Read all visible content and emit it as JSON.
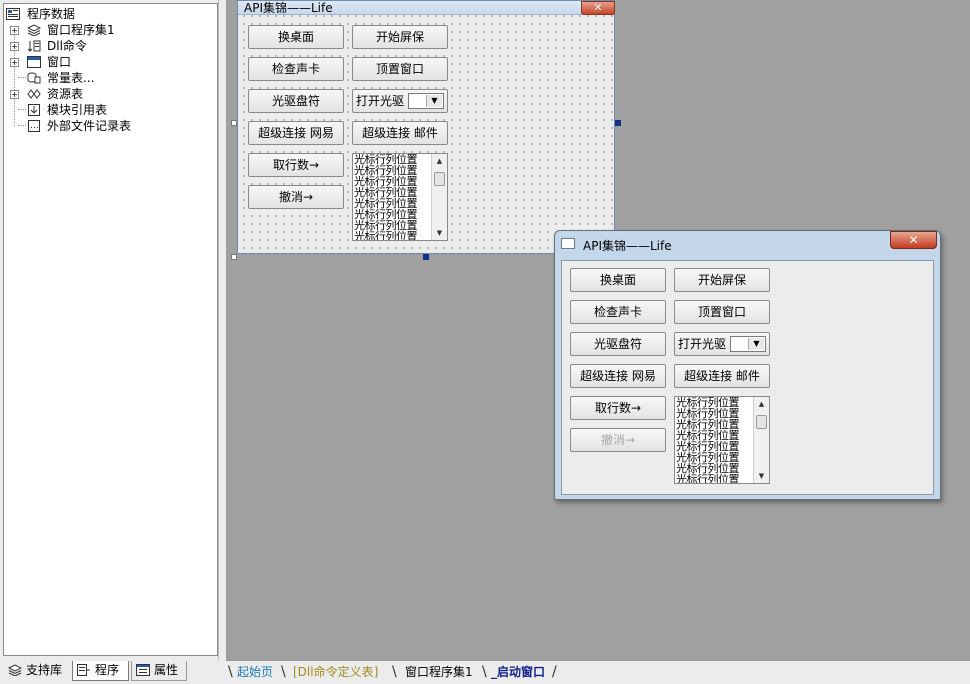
{
  "tree": {
    "root": "程序数据",
    "items": [
      {
        "label": "窗口程序集1",
        "icon": "layers-icon",
        "expander": "+"
      },
      {
        "label": "Dll命令",
        "icon": "dll-command-icon",
        "expander": "+"
      },
      {
        "label": "窗口",
        "icon": "window-icon",
        "expander": "+"
      },
      {
        "label": "常量表...",
        "icon": "constant-table-icon",
        "expander": ""
      },
      {
        "label": "资源表",
        "icon": "resource-icon",
        "expander": "+"
      },
      {
        "label": "模块引用表",
        "icon": "module-reference-icon",
        "expander": ""
      },
      {
        "label": "外部文件记录表",
        "icon": "external-file-icon",
        "expander": ""
      }
    ]
  },
  "left_tabs": [
    {
      "label": "支持库",
      "icon": "support-library-icon"
    },
    {
      "label": "程序",
      "icon": "program-icon"
    },
    {
      "label": "属性",
      "icon": "properties-icon"
    }
  ],
  "form": {
    "title": "API集锦——Life",
    "close_glyph": "✕",
    "buttons": {
      "change_desktop": "换桌面",
      "start_screensaver": "开始屏保",
      "check_soundcard": "检查声卡",
      "topmost_window": "顶置窗口",
      "drive_letter": "光驱盘符",
      "open_drive": "打开光驱",
      "link_163": "超级连接 网易",
      "link_mail": "超级连接 邮件",
      "get_line_count": "取行数→",
      "undo": "撤消→"
    },
    "list_items": [
      "光标行列位置",
      "光标行列位置",
      "光标行列位置",
      "光标行列位置",
      "光标行列位置",
      "光标行列位置",
      "光标行列位置",
      "光标行列位置"
    ]
  },
  "bottom_tabs": [
    {
      "label": "起始页",
      "color": "#1a7ab8"
    },
    {
      "label": "[Dll命令定义表]",
      "color": "#a08a20"
    },
    {
      "label": "窗口程序集1",
      "color": "#000000"
    },
    {
      "label": "_启动窗口",
      "color": "#10208a"
    }
  ]
}
